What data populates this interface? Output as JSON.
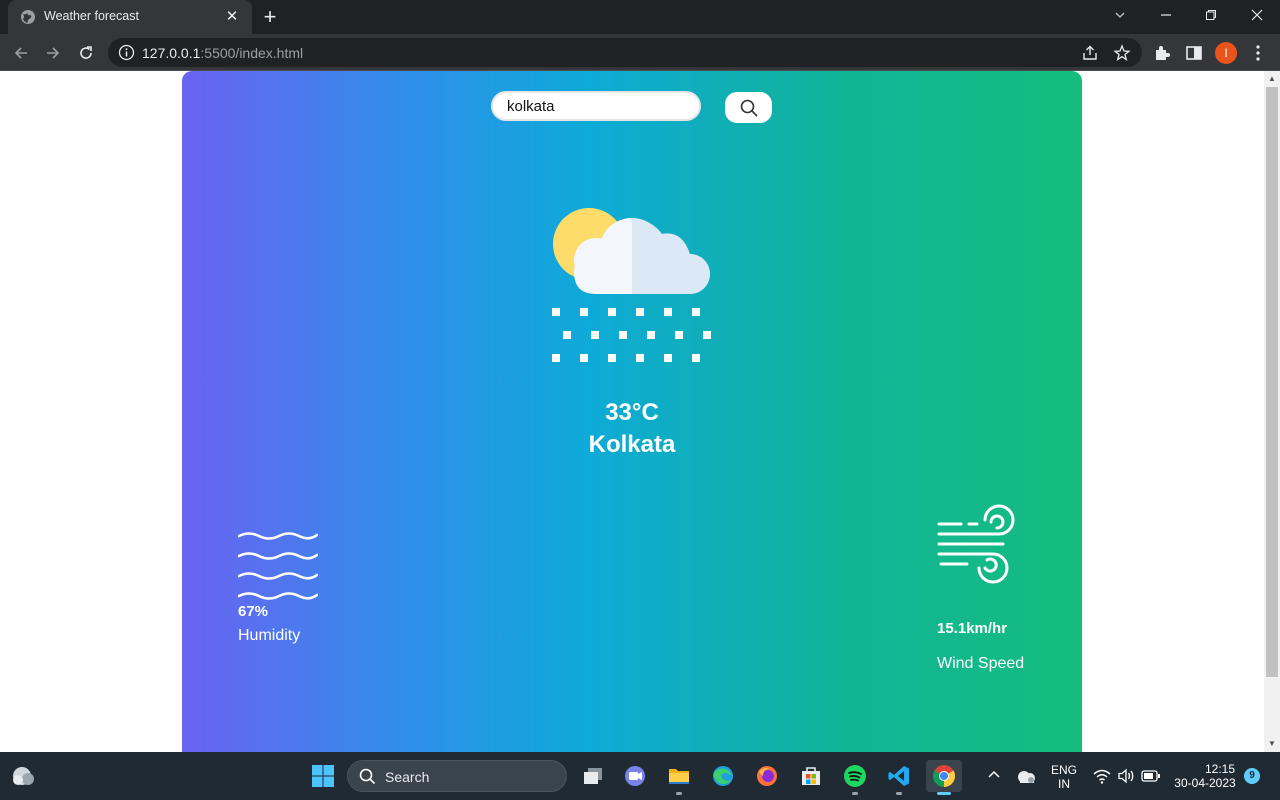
{
  "browser": {
    "tab_title": "Weather forecast",
    "url_host": "127.0.0.1",
    "url_rest": ":5500/index.html",
    "profile_initial": "I"
  },
  "app": {
    "search": {
      "value": "kolkata",
      "icon": "search-icon"
    },
    "weather_icon": "snow-cloud-sun-icon",
    "temperature": "33°C",
    "city": "Kolkata",
    "humidity": {
      "value": "67%",
      "label": "Humidity",
      "icon": "humidity-waves-icon"
    },
    "wind": {
      "value": "15.1km/hr",
      "label": "Wind Speed",
      "icon": "wind-icon"
    },
    "colors": {
      "gradient_start": "#6a62f2",
      "gradient_mid": "#0eaad8",
      "gradient_end": "#14bd7c"
    }
  },
  "taskbar": {
    "search_label": "Search",
    "lang_primary": "ENG",
    "lang_secondary": "IN",
    "time": "12:15",
    "date": "30-04-2023",
    "notification_count": "9"
  }
}
